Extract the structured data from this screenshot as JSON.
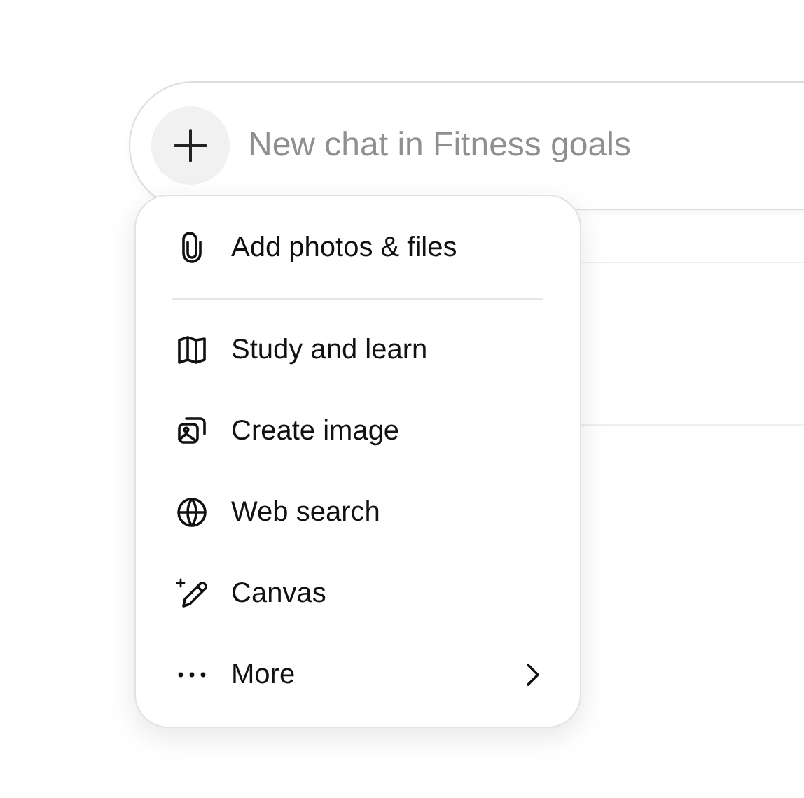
{
  "composer": {
    "placeholder": "New chat in Fitness goals"
  },
  "menu": {
    "sections": [
      [
        {
          "label": "Add photos & files",
          "kind": "action"
        }
      ],
      [
        {
          "label": "Study and learn",
          "kind": "action"
        },
        {
          "label": "Create image",
          "kind": "action"
        },
        {
          "label": "Web search",
          "kind": "action"
        },
        {
          "label": "Canvas",
          "kind": "action"
        },
        {
          "label": "More",
          "kind": "submenu"
        }
      ]
    ]
  }
}
